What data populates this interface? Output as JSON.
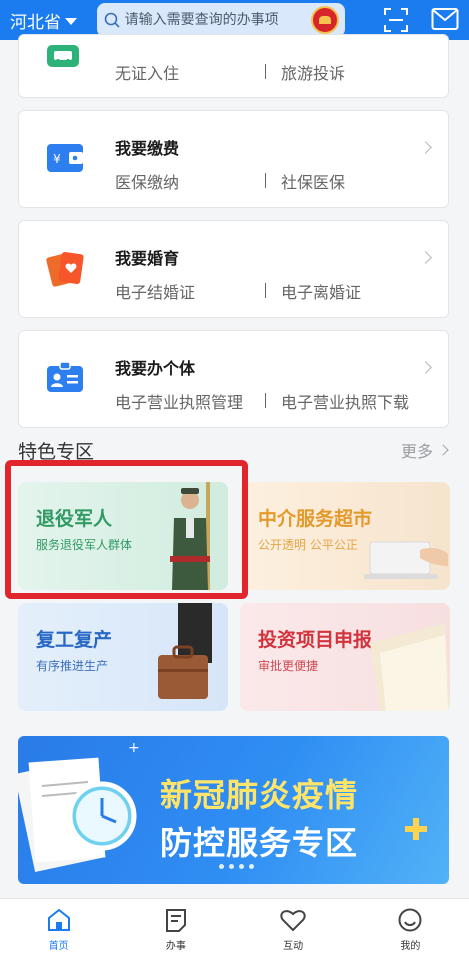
{
  "header": {
    "region": "河北省",
    "search_placeholder": "请输入需要查询的办事项"
  },
  "cards": [
    {
      "title": "",
      "left": "无证入住",
      "right": "旅游投诉",
      "icon": "car-card-icon"
    },
    {
      "title": "我要缴费",
      "left": "医保缴纳",
      "right": "社保医保",
      "icon": "wallet-icon"
    },
    {
      "title": "我要婚育",
      "left": "电子结婚证",
      "right": "电子离婚证",
      "icon": "heart-cards-icon"
    },
    {
      "title": "我要办个体",
      "left": "电子营业执照管理",
      "right": "电子营业执照下载",
      "icon": "id-card-icon"
    }
  ],
  "featured": {
    "title": "特色专区",
    "more": "更多",
    "tiles": [
      {
        "title": "退役军人",
        "subtitle": "服务退役军人群体"
      },
      {
        "title": "中介服务超市",
        "subtitle": "公开透明 公平公正"
      },
      {
        "title": "复工复产",
        "subtitle": "有序推进生产"
      },
      {
        "title": "投资项目申报",
        "subtitle": "审批更便捷"
      }
    ]
  },
  "banner": {
    "line1": "新冠肺炎疫情",
    "line2": "防控服务专区"
  },
  "nav": [
    {
      "label": "首页",
      "icon": "home-icon",
      "active": true
    },
    {
      "label": "办事",
      "icon": "document-icon"
    },
    {
      "label": "互动",
      "icon": "heart-icon"
    },
    {
      "label": "我的",
      "icon": "profile-icon"
    }
  ],
  "colors": {
    "primary": "#1b7cf0",
    "highlight": "#e0252c"
  }
}
